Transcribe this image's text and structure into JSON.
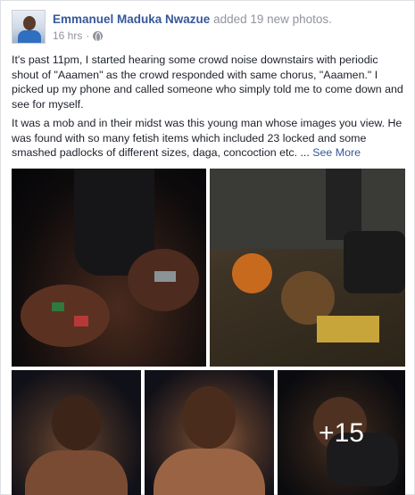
{
  "post": {
    "author": "Emmanuel Maduka Nwazue",
    "action": "added 19 new photos.",
    "time": "16 hrs",
    "separator": "·",
    "privacy_icon": "globe-icon",
    "paragraphs": [
      "It's past 11pm, I started hearing some crowd noise downstairs with periodic shout of \"Aaamen\" as the crowd responded with same chorus, \"Aaamen.\" I picked up my phone and called someone who simply told me to come down and see for myself.",
      "It was a mob and in their midst was this young man whose images you view. He was found with so many fetish items which included 23 locked and some smashed padlocks of different sizes, daga, concoction etc. ..."
    ],
    "see_more": "See More",
    "more_photos": "+15"
  },
  "colors": {
    "link": "#365899",
    "muted": "#90949c",
    "text": "#1d2129",
    "border": "#dddfe2"
  }
}
